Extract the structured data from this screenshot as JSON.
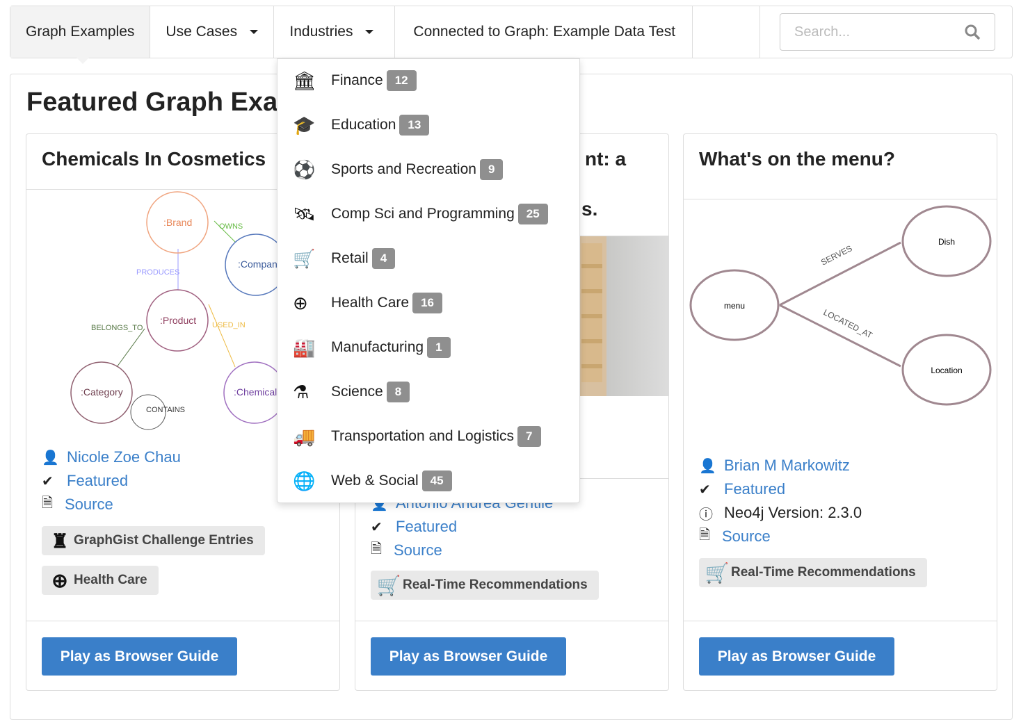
{
  "nav": {
    "tabs": [
      {
        "label": "Graph Examples"
      },
      {
        "label": "Use Cases"
      },
      {
        "label": "Industries"
      },
      {
        "label": "Connected to Graph: Example Data Test"
      }
    ],
    "search_placeholder": "Search..."
  },
  "page_title": "Featured Graph Examples",
  "industries": [
    {
      "label": "Finance",
      "count": "12",
      "icon": "bank-icon"
    },
    {
      "label": "Education",
      "count": "13",
      "icon": "graduation-cap-icon"
    },
    {
      "label": "Sports and Recreation",
      "count": "9",
      "icon": "soccer-ball-icon"
    },
    {
      "label": "Comp Sci and Programming",
      "count": "25",
      "icon": "satellite-icon"
    },
    {
      "label": "Retail",
      "count": "4",
      "icon": "cart-icon"
    },
    {
      "label": "Health Care",
      "count": "16",
      "icon": "plus-circle-icon"
    },
    {
      "label": "Manufacturing",
      "count": "1",
      "icon": "factory-icon"
    },
    {
      "label": "Science",
      "count": "8",
      "icon": "flask-icon"
    },
    {
      "label": "Transportation and Logistics",
      "count": "7",
      "icon": "truck-icon"
    },
    {
      "label": "Web & Social",
      "count": "45",
      "icon": "globe-icon"
    }
  ],
  "cards": [
    {
      "title": "Chemicals In Cosmetics",
      "author": "Nicole Zoe Chau",
      "featured": "Featured",
      "source": "Source",
      "tags": [
        "GraphGist Challenge Entries",
        "Health Care"
      ],
      "button": "Play as Browser Guide",
      "diagram": {
        "nodes": [
          ":Brand",
          ":Company",
          ":Product",
          ":Category",
          ":Chemical"
        ],
        "rels": [
          "OWNS",
          "PRODUCES",
          "BELONGS_TO",
          "USED_IN",
          "CONTAINS"
        ]
      }
    },
    {
      "title_fragment_1": "nt: a",
      "title_fragment_2": "s.",
      "author": "Antonio Andrea Gentile",
      "featured": "Featured",
      "source": "Source",
      "tags": [
        "Real-Time Recommendations"
      ],
      "button": "Play as Browser Guide"
    },
    {
      "title": "What's on the menu?",
      "author": "Brian M Markowitz",
      "featured": "Featured",
      "version": "Neo4j Version: 2.3.0",
      "source": "Source",
      "tags": [
        "Real-Time Recommendations"
      ],
      "button": "Play as Browser Guide",
      "diagram": {
        "nodes": [
          "menu",
          "Dish",
          "Location"
        ],
        "rels": [
          "SERVES",
          "LOCATED_AT"
        ]
      }
    }
  ]
}
